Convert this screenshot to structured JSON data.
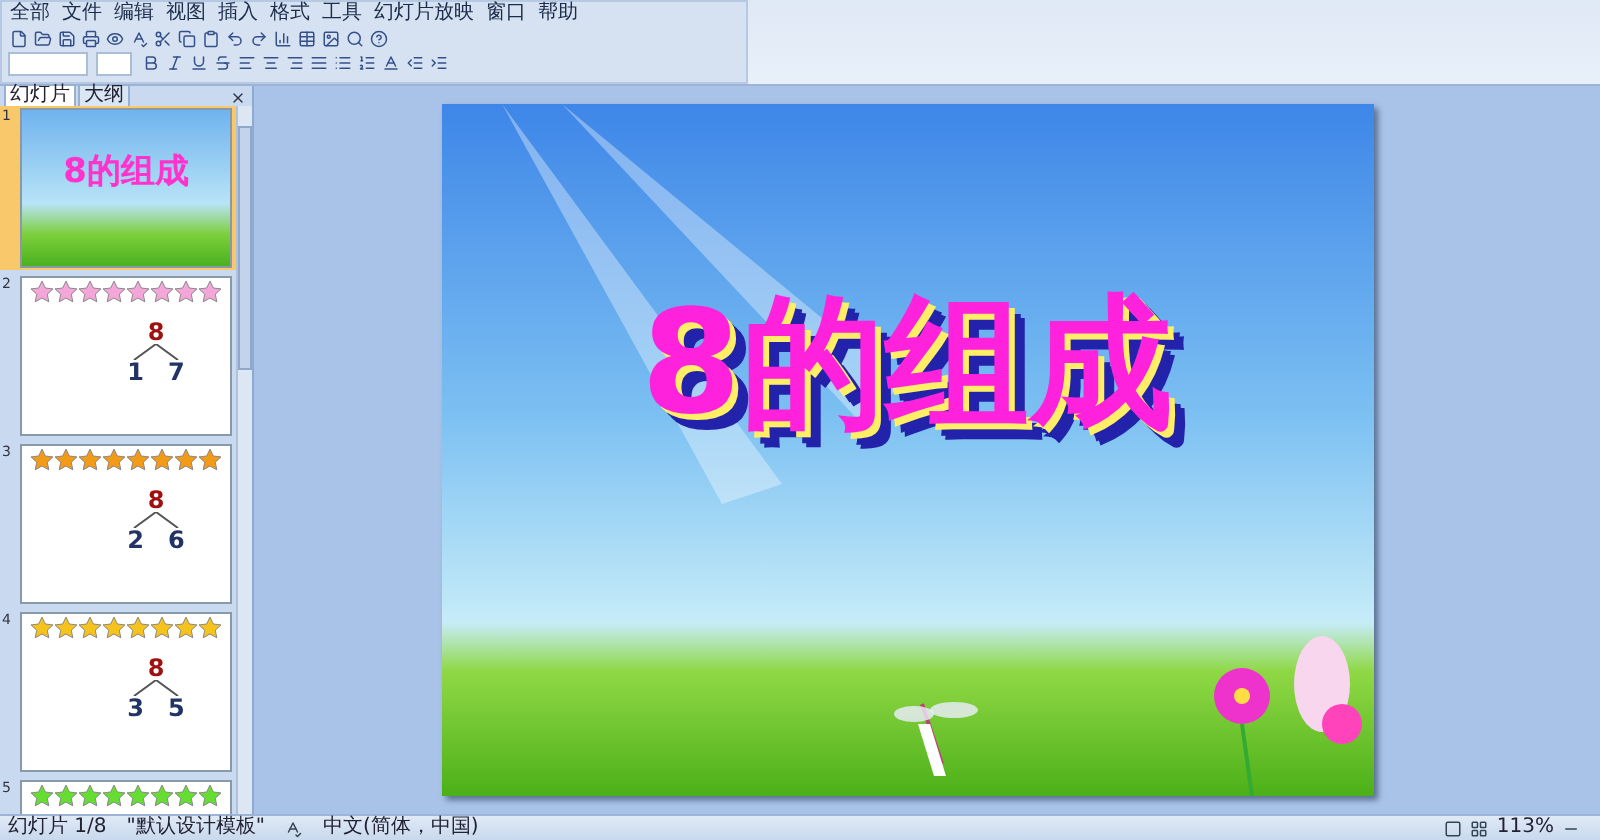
{
  "menu": [
    "全部",
    "文件",
    "编辑",
    "视图",
    "插入",
    "格式",
    "工具",
    "幻灯片放映",
    "窗口",
    "帮助"
  ],
  "panel_tabs": [
    {
      "label": "幻灯片",
      "selected": true
    },
    {
      "label": "大纲",
      "selected": false
    }
  ],
  "slides": [
    {
      "number": "1",
      "kind": "title",
      "title": "8的组成",
      "selected": true
    },
    {
      "number": "2",
      "kind": "stars",
      "stars": 8,
      "color": "#f4a6d8",
      "total": "8",
      "parts": [
        "1",
        "7"
      ],
      "selected": false
    },
    {
      "number": "3",
      "kind": "stars",
      "stars": 8,
      "color": "#f39a16",
      "total": "8",
      "parts": [
        "2",
        "6"
      ],
      "selected": false
    },
    {
      "number": "4",
      "kind": "stars",
      "stars": 8,
      "color": "#f6c21c",
      "total": "8",
      "parts": [
        "3",
        "5"
      ],
      "selected": false
    },
    {
      "number": "5",
      "kind": "stars",
      "stars": 8,
      "color": "#66dd33",
      "selected": false
    }
  ],
  "main_slide": {
    "title": "8的组成"
  },
  "status_bar": {
    "slide": "幻灯片 1/8",
    "template": "\"默认设计模板\"",
    "language": "中文(简体，中国)",
    "zoom": "113%"
  }
}
